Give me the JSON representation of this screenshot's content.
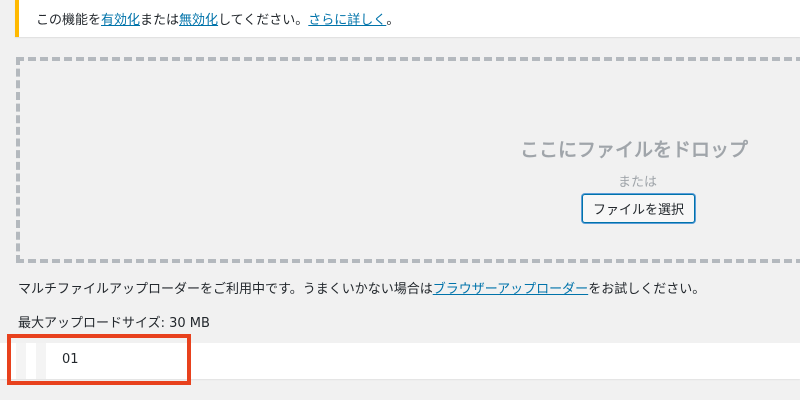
{
  "notice": {
    "text_before": "この機能を",
    "activate_link": "有効化",
    "text_or": "または",
    "deactivate_link": "無効化",
    "text_after": "してください。",
    "more_link": "さらに詳しく",
    "end": "。"
  },
  "dropzone": {
    "title": "ここにファイルをドロップ",
    "or": "または",
    "select_button": "ファイルを選択"
  },
  "uploader_info": {
    "text_before": "マルチファイルアップローダーをご利用中です。うまくいかない場合は",
    "browser_uploader_link": "ブラウザーアップローダー",
    "text_after": "をお試しください。"
  },
  "max_upload": "最大アップロードサイズ: 30 MB",
  "media_items": [
    {
      "name": "01"
    }
  ],
  "colors": {
    "notice_border": "#ffb900",
    "link": "#0073aa",
    "highlight": "#e8411d"
  }
}
